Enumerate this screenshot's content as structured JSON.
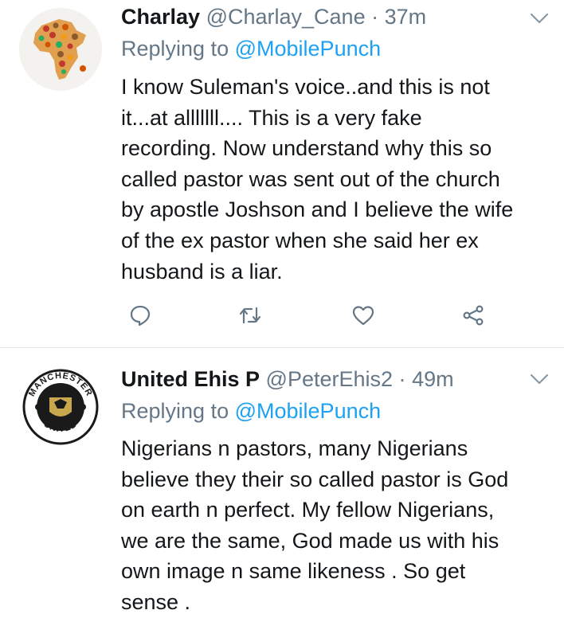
{
  "tweets": [
    {
      "name": "Charlay",
      "handle": "@Charlay_Cane",
      "separator": "·",
      "time": "37m",
      "replying_prefix": "Replying to",
      "replying_to": "@MobilePunch",
      "lines": [
        "I know Suleman's voice..and this is not",
        "it...at alllllll.... This is a very fake",
        "recording. Now understand why this so",
        "called pastor was sent out of the church",
        "by apostle Joshson and I believe the wife",
        "of the ex pastor when she said her ex",
        "husband  is a liar."
      ],
      "avatar_icon": "africa-map-avatar"
    },
    {
      "name": "United Ehis P",
      "handle": "@PeterEhis2",
      "separator": "·",
      "time": "49m",
      "replying_prefix": "Replying to",
      "replying_to": "@MobilePunch",
      "lines": [
        "Nigerians n pastors, many Nigerians",
        "believe they their so called pastor is God",
        "on earth n perfect. My fellow Nigerians,",
        "we are the same, God made us with his",
        "own image n same likeness . So get",
        "sense ."
      ],
      "avatar_icon": "manchester-united-crest-avatar",
      "avatar_text_top": "MANCHESTER",
      "avatar_text_bottom": "UNITED"
    }
  ],
  "icons": {
    "reply": "reply-icon",
    "retweet": "retweet-icon",
    "like": "heart-icon",
    "share": "share-icon",
    "menu": "chevron-down-icon"
  },
  "colors": {
    "text": "#14171a",
    "secondary": "#657786",
    "link": "#1da1f2",
    "divider": "#e1e8ed"
  }
}
